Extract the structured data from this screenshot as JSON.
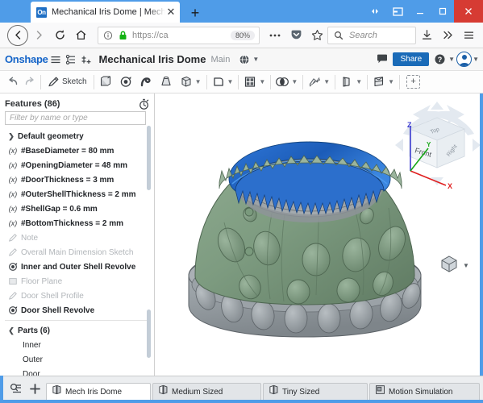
{
  "browser": {
    "tab": {
      "title": "Mechanical Iris Dome | Mech Iri",
      "favicon_text": "On",
      "favicon_name": "onshape-favicon",
      "close_label": "✕"
    },
    "newtab_label": "+",
    "window_controls": {
      "restore_down_label": "restore-down",
      "minimize_label": "minimize",
      "maximize_label": "maximize",
      "close_label": "close"
    },
    "nav": {
      "back_label": "back",
      "forward_label": "forward",
      "reload_label": "reload",
      "home_label": "home"
    },
    "url": {
      "value": "https://ca",
      "zoom": "80%",
      "identity_icon": "info-circle-icon",
      "lock_icon": "padlock-icon"
    },
    "search": {
      "placeholder": "Search"
    },
    "toolbar_right": {
      "downloads_label": "downloads",
      "overflow_label": "»",
      "menu_label": "menu"
    }
  },
  "onshape_header": {
    "logo": "Onshape",
    "menu_icon": "hamburger-menu-icon",
    "versions_icon": "version-graph-icon",
    "insert_icon": "add-version-icon",
    "document_title": "Mechanical Iris Dome",
    "workspace": "Main",
    "globe_icon": "globe-icon",
    "comments_icon": "comment-icon",
    "share_label": "Share",
    "help_icon": "help-circle-icon",
    "account_icon": "user-avatar-icon"
  },
  "feature_toolbar": {
    "undo_label": "undo",
    "redo_label": "redo",
    "sketch_label": "Sketch",
    "tools": [
      {
        "name": "extrude-icon"
      },
      {
        "name": "revolve-icon"
      },
      {
        "name": "sweep-icon"
      },
      {
        "name": "loft-icon"
      },
      {
        "name": "fillet-icon",
        "dropdown": true
      },
      {
        "name": "shell-icon",
        "dropdown": true
      },
      {
        "name": "pattern-icon",
        "dropdown": true
      },
      {
        "name": "boolean-icon",
        "dropdown": true
      },
      {
        "name": "transform-icon",
        "dropdown": true
      },
      {
        "name": "draft-icon",
        "dropdown": true
      },
      {
        "name": "split-icon",
        "dropdown": true
      }
    ],
    "add_feature_label": "+"
  },
  "features_panel": {
    "title": "Features (86)",
    "history_icon": "stopwatch-icon",
    "filter_placeholder": "Filter by name or type",
    "items": [
      {
        "label": "Default geometry",
        "icon": "chevron-right-icon",
        "style": "group"
      },
      {
        "label": "#BaseDiameter = 80 mm",
        "icon": "variable-icon",
        "style": "bold"
      },
      {
        "label": "#OpeningDiameter = 48 mm",
        "icon": "variable-icon",
        "style": "bold"
      },
      {
        "label": "#DoorThickness = 3 mm",
        "icon": "variable-icon",
        "style": "bold"
      },
      {
        "label": "#OuterShellThickness = 2 mm",
        "icon": "variable-icon",
        "style": "bold"
      },
      {
        "label": "#ShellGap = 0.6 mm",
        "icon": "variable-icon",
        "style": "bold"
      },
      {
        "label": "#BottomThickness = 2 mm",
        "icon": "variable-icon",
        "style": "bold"
      },
      {
        "label": "Note",
        "icon": "sketch-icon",
        "style": "dim"
      },
      {
        "label": "Overall Main Dimension Sketch",
        "icon": "sketch-icon",
        "style": "dim"
      },
      {
        "label": "Inner and Outer Shell Revolve",
        "icon": "revolve-icon",
        "style": "bold"
      },
      {
        "label": "Floor Plane",
        "icon": "plane-icon",
        "style": "dim"
      },
      {
        "label": "Door Shell Profile",
        "icon": "sketch-icon",
        "style": "dim"
      },
      {
        "label": "Door Shell Revolve",
        "icon": "revolve-icon",
        "style": "bold"
      }
    ],
    "parts": {
      "label": "Parts (6)",
      "icon": "chevron-down-icon",
      "items": [
        {
          "label": "Inner"
        },
        {
          "label": "Outer"
        },
        {
          "label": "Door"
        }
      ]
    }
  },
  "viewport": {
    "view_cube": {
      "top_label": "Top",
      "front_label": "Front",
      "right_label": "Right",
      "axis_x": "X",
      "axis_y": "Y",
      "axis_z": "Z",
      "x_color": "#e02020",
      "y_color": "#18a818",
      "z_color": "#3c3cd0"
    },
    "display_icon": "view-mode-cube-icon",
    "model": {
      "body_color": "#7d9b80",
      "base_color": "#9aa1a6",
      "ring_color": "#1f63c8",
      "interior_color": "#8b8f93"
    }
  },
  "bottom_tabs": {
    "filter_icon": "tab-filter-icon",
    "add_label": "+",
    "tabs": [
      {
        "label": "Mech Iris Dome",
        "icon": "part-studio-icon",
        "active": true
      },
      {
        "label": "Medium Sized",
        "icon": "part-studio-icon",
        "active": false
      },
      {
        "label": "Tiny Sized",
        "icon": "part-studio-icon",
        "active": false
      },
      {
        "label": "Motion Simulation",
        "icon": "assembly-icon",
        "active": false
      }
    ]
  }
}
